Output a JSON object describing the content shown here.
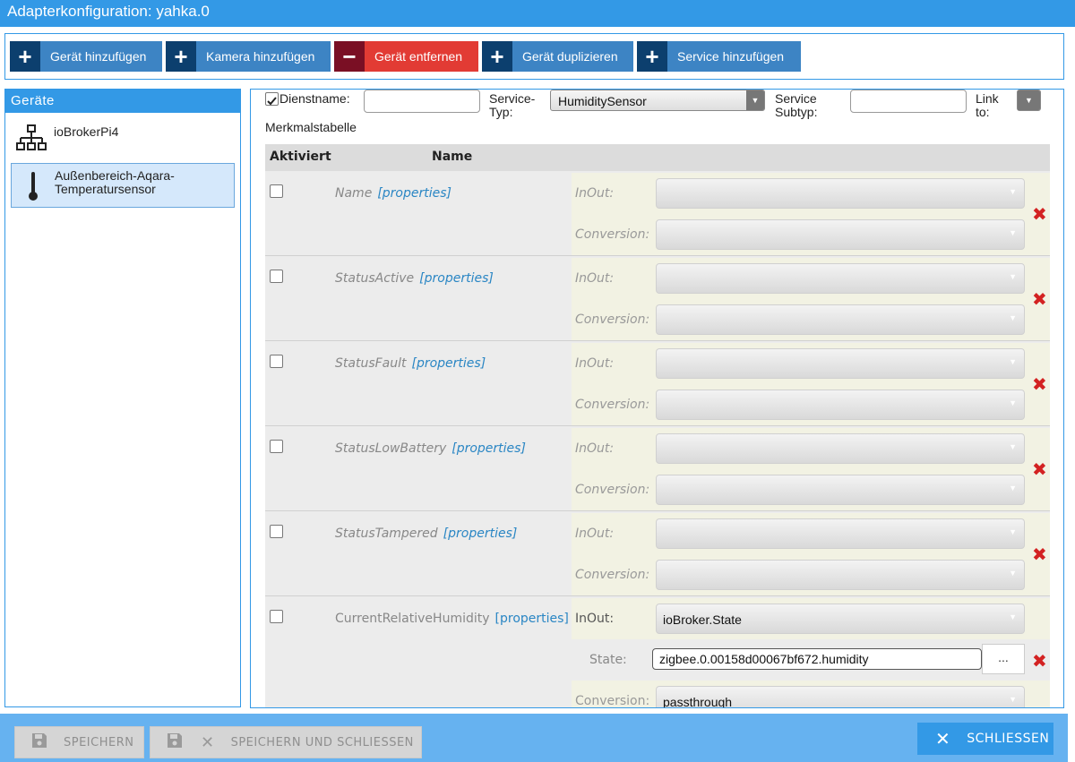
{
  "window": {
    "title": "Adapterkonfiguration: yahka.0"
  },
  "toolbar": {
    "buttons": [
      {
        "icon": "plus-icon",
        "label": "Gerät hinzufügen"
      },
      {
        "icon": "plus-icon",
        "label": "Kamera hinzufügen"
      },
      {
        "icon": "minus-icon",
        "label": "Gerät entfernen"
      },
      {
        "icon": "plus-icon",
        "label": "Gerät duplizieren"
      },
      {
        "icon": "plus-icon",
        "label": "Service hinzufügen"
      }
    ],
    "plus_glyph": "+",
    "minus_glyph": "−"
  },
  "devices": {
    "header": "Geräte",
    "items": [
      {
        "icon": "network-tree-icon",
        "name": "ioBrokerPi4",
        "selected": false
      },
      {
        "icon": "thermometer-icon",
        "name": "Außenbereich-Aqara-Temperatursensor",
        "selected": true
      }
    ]
  },
  "service": {
    "enabled_checked": true,
    "name_label": "Dienstname:",
    "name_value": "",
    "type_label": "Service-Typ:",
    "type_value": "HumiditySensor",
    "subtype_label": "Service Subtyp:",
    "subtype_value": "",
    "link_label": "Link to:",
    "table_title": "Merkmalstabelle"
  },
  "characteristics": {
    "headers": {
      "activated": "Aktiviert",
      "name": "Name"
    },
    "properties_link": "[properties]",
    "inout_label": "InOut:",
    "conversion_label": "Conversion:",
    "state_label": "State:",
    "rows": [
      {
        "name": "Name",
        "inout": "",
        "conversion": ""
      },
      {
        "name": "StatusActive",
        "inout": "",
        "conversion": ""
      },
      {
        "name": "StatusFault",
        "inout": "",
        "conversion": ""
      },
      {
        "name": "StatusLowBattery",
        "inout": "",
        "conversion": ""
      },
      {
        "name": "StatusTampered",
        "inout": "",
        "conversion": ""
      },
      {
        "name": "CurrentRelativeHumidity",
        "inout": "ioBroker.State",
        "state": "zigbee.0.00158d00067bf672.humidity",
        "state_button": "...",
        "conversion": "passthrough"
      }
    ]
  },
  "footer": {
    "save_label": "SPEICHERN",
    "save_close_label": "SPEICHERN UND SCHLIESSEN",
    "close_label": "SCHLIESSEN"
  },
  "colors": {
    "primary": "#3399e6",
    "button_blue": "#3d84c4",
    "button_icon_dark": "#0c3f6e",
    "danger": "#e23b34",
    "danger_icon": "#7a0f24",
    "remove_x": "#d32222",
    "footer_bg": "#66b2f0"
  }
}
